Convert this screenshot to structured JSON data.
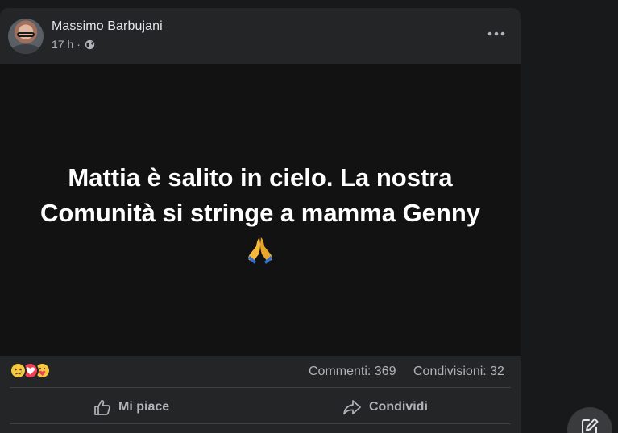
{
  "post": {
    "author": "Massimo Barbujani",
    "time": "17 h",
    "separator": "·",
    "privacy_icon": "globe-icon",
    "menu_icon": "more-horizontal-icon",
    "text_line_1": "Mattia è salito in cielo. La nostra",
    "text_line_2": "Comunità si stringe a mamma Genny",
    "emoji": "folded-hands-emoji",
    "reactions": [
      "sad-reaction",
      "love-reaction",
      "care-reaction"
    ],
    "comments": "Commenti: 369",
    "shares": "Condivisioni: 32",
    "actions": {
      "like_label": "Mi piace",
      "share_label": "Condividi"
    }
  },
  "compose_icon": "compose-icon",
  "colors": {
    "page_background": "#18191a",
    "card_background": "#242526",
    "image_background": "#121212",
    "primary_text": "#e4e6eb",
    "secondary_text": "#b0b3b8",
    "love_red": "#f33e58",
    "emoji_yellow": "#f7c940"
  }
}
